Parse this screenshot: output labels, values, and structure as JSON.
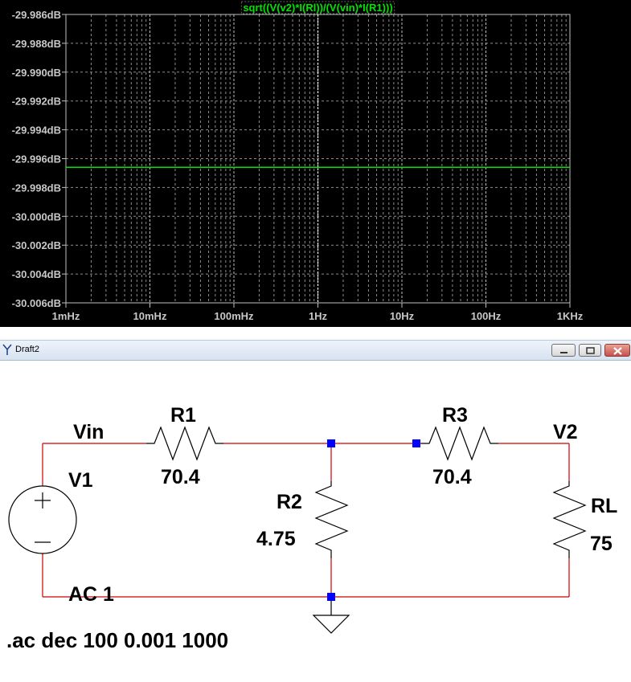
{
  "plot": {
    "trace_label": "sqrt((V(v2)*I(Rl))/(V(vin)*I(R1)))",
    "trace_color": "#00e400",
    "trace_value_db": -29.9966,
    "y_ticks": [
      "-29.986dB",
      "-29.988dB",
      "-29.990dB",
      "-29.992dB",
      "-29.994dB",
      "-29.996dB",
      "-29.998dB",
      "-30.000dB",
      "-30.002dB",
      "-30.004dB",
      "-30.006dB"
    ],
    "x_ticks": [
      "1mHz",
      "10mHz",
      "100mHz",
      "1Hz",
      "10Hz",
      "100Hz",
      "1KHz"
    ]
  },
  "chart_data": {
    "type": "line",
    "x_scale": "log",
    "xlim": [
      0.001,
      1000
    ],
    "ylim": [
      -30.006,
      -29.986
    ],
    "y_unit": "dB",
    "series": [
      {
        "name": "sqrt((V(v2)*I(Rl))/(V(vin)*I(R1)))",
        "x": [
          0.001,
          1000
        ],
        "y": [
          -29.9966,
          -29.9966
        ]
      }
    ]
  },
  "window": {
    "title": "Draft2",
    "minimize_icon": "minimize-icon",
    "maximize_icon": "maximize-icon",
    "close_icon": "close-icon"
  },
  "schematic": {
    "wire_color": "#cc0000",
    "node_color": "#0000ff",
    "labels": {
      "vin": "Vin",
      "v2": "V2",
      "v1_name": "V1",
      "v1_value": "AC 1",
      "r1_name": "R1",
      "r1_value": "70.4",
      "r2_name": "R2",
      "r2_value": "4.75",
      "r3_name": "R3",
      "r3_value": "70.4",
      "rl_name": "RL",
      "rl_value": "75"
    },
    "directive": ".ac dec 100 0.001 1000"
  }
}
